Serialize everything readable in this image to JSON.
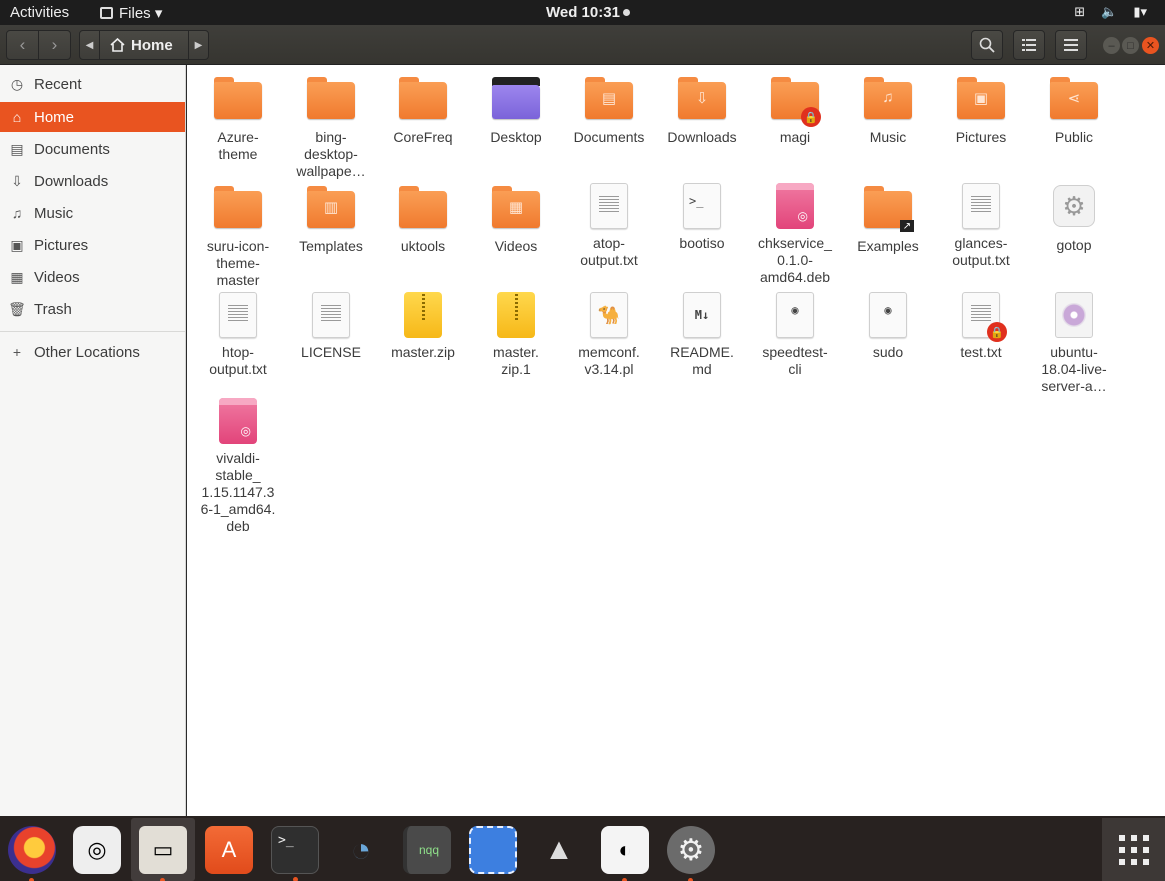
{
  "topbar": {
    "activities": "Activities",
    "app_menu": "Files ▾",
    "clock": "Wed 10:31"
  },
  "header": {
    "path": "Home"
  },
  "sidebar": {
    "items": [
      {
        "label": "Recent",
        "icon": "clock-icon"
      },
      {
        "label": "Home",
        "icon": "home-icon",
        "active": true
      },
      {
        "label": "Documents",
        "icon": "document-icon"
      },
      {
        "label": "Downloads",
        "icon": "download-icon"
      },
      {
        "label": "Music",
        "icon": "music-icon"
      },
      {
        "label": "Pictures",
        "icon": "image-icon"
      },
      {
        "label": "Videos",
        "icon": "video-icon"
      },
      {
        "label": "Trash",
        "icon": "trash-icon"
      }
    ],
    "other_locations": "Other Locations"
  },
  "files": [
    {
      "label": "Azure-\ntheme",
      "kind": "folder"
    },
    {
      "label": "bing-\ndesktop-\nwallpape…",
      "kind": "folder"
    },
    {
      "label": "CoreFreq",
      "kind": "folder"
    },
    {
      "label": "Desktop",
      "kind": "folder-desktop"
    },
    {
      "label": "Documents",
      "kind": "folder-documents"
    },
    {
      "label": "Downloads",
      "kind": "folder-downloads"
    },
    {
      "label": "magi",
      "kind": "folder-locked"
    },
    {
      "label": "Music",
      "kind": "folder-music"
    },
    {
      "label": "Pictures",
      "kind": "folder-pictures"
    },
    {
      "label": "Public",
      "kind": "folder-public"
    },
    {
      "label": "suru-icon-\ntheme-\nmaster",
      "kind": "folder"
    },
    {
      "label": "Templates",
      "kind": "folder-templates"
    },
    {
      "label": "uktools",
      "kind": "folder"
    },
    {
      "label": "Videos",
      "kind": "folder-videos"
    },
    {
      "label": "atop-\noutput.txt",
      "kind": "text"
    },
    {
      "label": "bootiso",
      "kind": "script"
    },
    {
      "label": "chkservice_\n0.1.0-\namd64.deb",
      "kind": "deb"
    },
    {
      "label": "Examples",
      "kind": "folder-link"
    },
    {
      "label": "glances-\noutput.txt",
      "kind": "text"
    },
    {
      "label": "gotop",
      "kind": "executable"
    },
    {
      "label": "htop-\noutput.txt",
      "kind": "text"
    },
    {
      "label": "LICENSE",
      "kind": "text"
    },
    {
      "label": "master.zip",
      "kind": "zip"
    },
    {
      "label": "master.\nzip.1",
      "kind": "zip"
    },
    {
      "label": "memconf.\nv3.14.pl",
      "kind": "perl"
    },
    {
      "label": "README.\nmd",
      "kind": "markdown"
    },
    {
      "label": "speedtest-\ncli",
      "kind": "python"
    },
    {
      "label": "sudo",
      "kind": "python"
    },
    {
      "label": "test.txt",
      "kind": "text-locked"
    },
    {
      "label": "ubuntu-\n18.04-live-\nserver-a…",
      "kind": "iso"
    },
    {
      "label": "vivaldi-\nstable_\n1.15.1147.3\n6-1_amd64.\ndeb",
      "kind": "deb"
    }
  ],
  "dock": [
    {
      "name": "firefox",
      "icon": "firefox-icon",
      "running": true
    },
    {
      "name": "rhythmbox",
      "icon": "speaker-icon",
      "running": false
    },
    {
      "name": "files",
      "icon": "files-icon",
      "running": true
    },
    {
      "name": "software",
      "icon": "software-center-icon",
      "running": false
    },
    {
      "name": "terminal",
      "icon": "terminal-icon",
      "running": true
    },
    {
      "name": "shutter",
      "icon": "aperture-icon",
      "running": false
    },
    {
      "name": "notepadqq",
      "icon": "notebook-icon",
      "running": false
    },
    {
      "name": "screenshot",
      "icon": "screenshot-icon",
      "running": false
    },
    {
      "name": "inkscape",
      "icon": "inkscape-icon",
      "running": false
    },
    {
      "name": "tweaks",
      "icon": "toggle-icon",
      "running": true
    },
    {
      "name": "settings",
      "icon": "settings-gear-icon",
      "running": true
    }
  ],
  "dock_labels": {
    "notepadqq": "nqq",
    "terminal": ">_"
  }
}
